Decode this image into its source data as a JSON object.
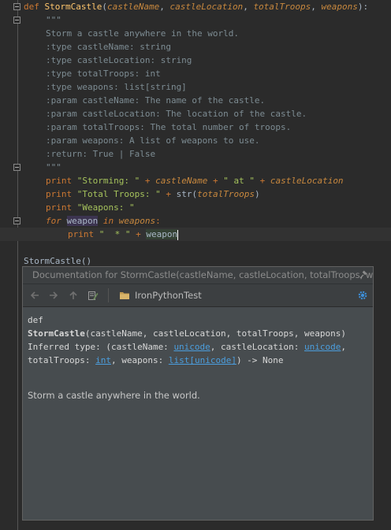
{
  "editor": {
    "def_line": {
      "kw": "def",
      "name": "StormCastle",
      "open": "(",
      "p1": "castleName",
      "sep1": ", ",
      "p2": "castleLocation",
      "sep2": ", ",
      "p3": "totalTroops",
      "sep3": ", ",
      "p4": "weapons",
      "close": "):"
    },
    "docstring": [
      "\"\"\"",
      "Storm a castle anywhere in the world.",
      ":type castleName: string",
      ":type castleLocation: string",
      ":type totalTroops: int",
      ":type weapons: list[string]",
      ":param castleName: The name of the castle.",
      ":param castleLocation: The location of the castle.",
      ":param totalTroops: The total number of troops.",
      ":param weapons: A list of weapons to use.",
      ":return: True | False",
      "\"\"\""
    ],
    "print1": {
      "kw": "print",
      "s1": "\"Storming: \"",
      "op1": " + ",
      "v1": "castleName",
      "op2": " + ",
      "s2": "\" at \"",
      "op3": " + ",
      "v2": "castleLocation"
    },
    "print2": {
      "kw": "print",
      "s1": "\"Total Troops: \"",
      "op1": " + ",
      "fn": "str",
      "open": "(",
      "v1": "totalTroops",
      "close": ")"
    },
    "print3": {
      "kw": "print",
      "s1": "\"Weapons: \""
    },
    "for_line": {
      "kw1": "for",
      "var": "weapon",
      "kw2": "in",
      "iter": "weapons",
      "colon": ":"
    },
    "print4": {
      "kw": "print",
      "s1": "\"  * \"",
      "op1": " + ",
      "var": "weapon"
    },
    "call": {
      "name": "StormCastle",
      "open": "(",
      "close": ")"
    }
  },
  "popup": {
    "title": "Documentation for StormCastle(castleName, castleLocation, totalTroops, w...",
    "project": "IronPythonTest",
    "toolbar_icons": [
      "back-arrow-icon",
      "forward-arrow-icon",
      "up-arrow-icon",
      "edit-source-icon",
      "folder-icon",
      "settings-gear-icon",
      "pin-icon"
    ],
    "doc": {
      "def_kw": "def",
      "signature_name": "StormCastle",
      "signature_args": "(castleName, castleLocation, totalTroops, weapons)",
      "inferred_prefix": "Inferred type: (castleName: ",
      "t1": "unicode",
      "mid1": ", castleLocation: ",
      "t2": "unicode",
      "mid2": ",",
      "line3_prefix": "totalTroops: ",
      "t3": "int",
      "mid3": ", weapons: ",
      "t4": "list",
      "bracket_open": "[",
      "t5": "unicode",
      "bracket_close": "]",
      "returns": ") -> None",
      "description": "Storm a castle anywhere in the world."
    }
  },
  "colors": {
    "background": "#2b2b2b",
    "keyword": "#cc7832",
    "function": "#ffc66d",
    "string": "#a5c25c",
    "docstring": "#7d8c93",
    "link": "#4b9ede"
  }
}
